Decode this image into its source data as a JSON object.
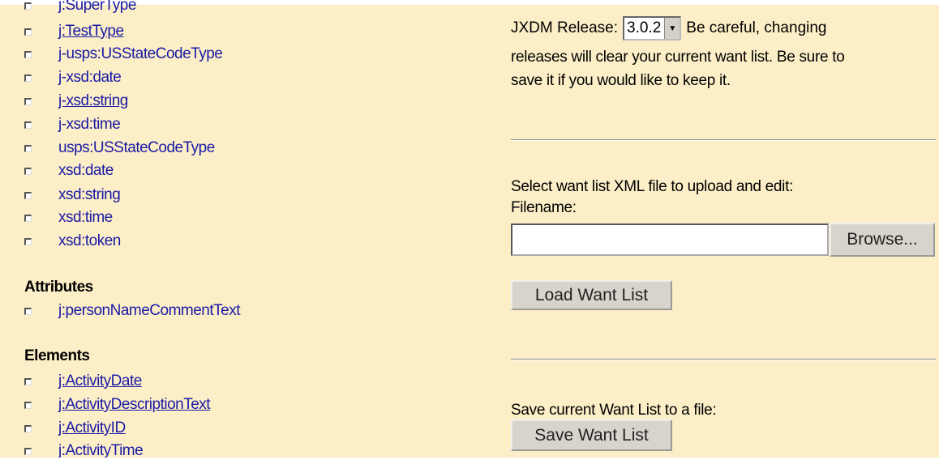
{
  "types": [
    {
      "label": "j:SuperType",
      "link": false
    },
    {
      "label": "j:TestType",
      "link": true
    },
    {
      "label": "j-usps:USStateCodeType",
      "link": false
    },
    {
      "label": "j-xsd:date",
      "link": false
    },
    {
      "label": "j-xsd:string",
      "link": true
    },
    {
      "label": "j-xsd:time",
      "link": false
    },
    {
      "label": "usps:USStateCodeType",
      "link": false
    },
    {
      "label": "xsd:date",
      "link": false
    },
    {
      "label": "xsd:string",
      "link": false
    },
    {
      "label": "xsd:time",
      "link": false
    },
    {
      "label": "xsd:token",
      "link": false
    }
  ],
  "attributes": {
    "heading": "Attributes",
    "items": [
      {
        "label": "j:personNameCommentText",
        "link": false
      }
    ]
  },
  "elements": {
    "heading": "Elements",
    "items": [
      {
        "label": "j:ActivityDate",
        "link": true
      },
      {
        "label": "j:ActivityDescriptionText",
        "link": true
      },
      {
        "label": "j:ActivityID",
        "link": true
      },
      {
        "label": "j:ActivityTime",
        "link": false
      }
    ]
  },
  "release": {
    "label": "JXDM Release:",
    "selected": "3.0.2",
    "warning_line1": "Be careful, changing",
    "warning_line2": "releases will clear your current want list. Be sure to",
    "warning_line3": "save it if you would like to keep it."
  },
  "upload": {
    "prompt": "Select want list XML file to upload and edit:",
    "filename_label": "Filename:",
    "filename_value": "",
    "browse_label": "Browse...",
    "load_label": "Load Want List"
  },
  "save": {
    "prompt": "Save current Want List to a file:",
    "save_label": "Save Want List"
  }
}
